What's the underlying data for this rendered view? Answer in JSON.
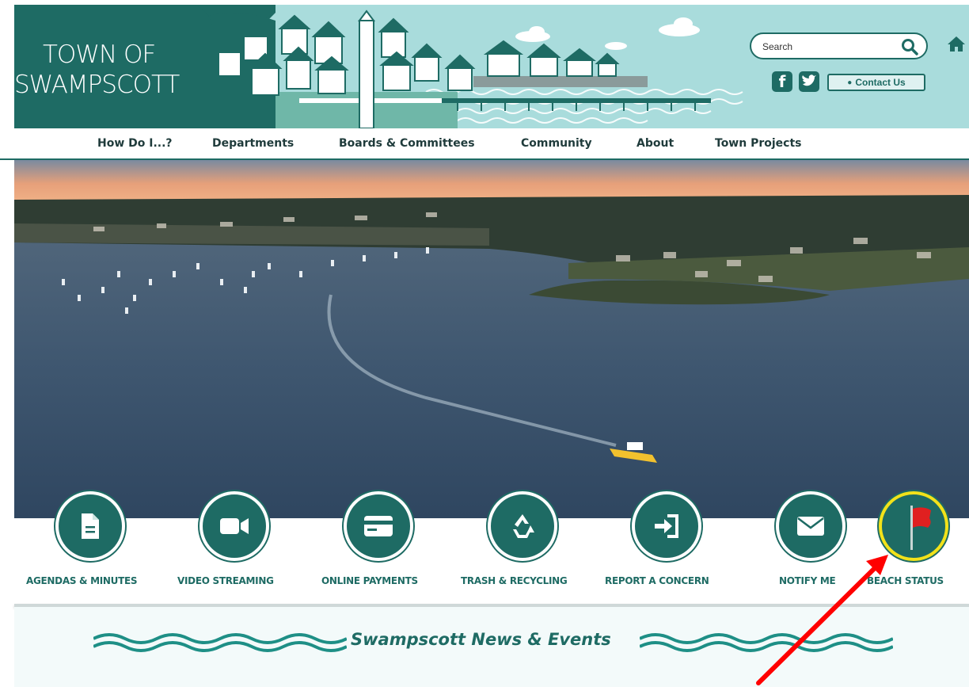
{
  "header": {
    "logo_line1": "TOWN OF",
    "logo_line2": "SWAMPSCOTT",
    "search_placeholder": "Search",
    "contact_label": "Contact Us",
    "social": [
      "facebook-icon",
      "twitter-icon"
    ]
  },
  "nav": {
    "items": [
      {
        "label": "How Do I...?"
      },
      {
        "label": "Departments"
      },
      {
        "label": "Boards & Committees"
      },
      {
        "label": "Community"
      },
      {
        "label": "About"
      },
      {
        "label": "Town Projects"
      }
    ]
  },
  "quick_links": [
    {
      "label": "AGENDAS & MINUTES",
      "icon": "document-icon"
    },
    {
      "label": "VIDEO STREAMING",
      "icon": "video-camera-icon"
    },
    {
      "label": "ONLINE PAYMENTS",
      "icon": "credit-card-icon"
    },
    {
      "label": "TRASH & RECYCLING",
      "icon": "recycle-icon"
    },
    {
      "label": "REPORT A CONCERN",
      "icon": "sign-in-icon"
    },
    {
      "label": "NOTIFY ME",
      "icon": "envelope-icon"
    },
    {
      "label": "BEACH STATUS",
      "icon": "red-flag-icon"
    }
  ],
  "news": {
    "title": "Swampscott News & Events"
  },
  "colors": {
    "brand_dark": "#1e6b64",
    "banner_light": "#a9dcdc",
    "highlight_ring": "#f2e21a",
    "flag_red": "#e02020",
    "annotation_arrow": "#ff0000"
  }
}
